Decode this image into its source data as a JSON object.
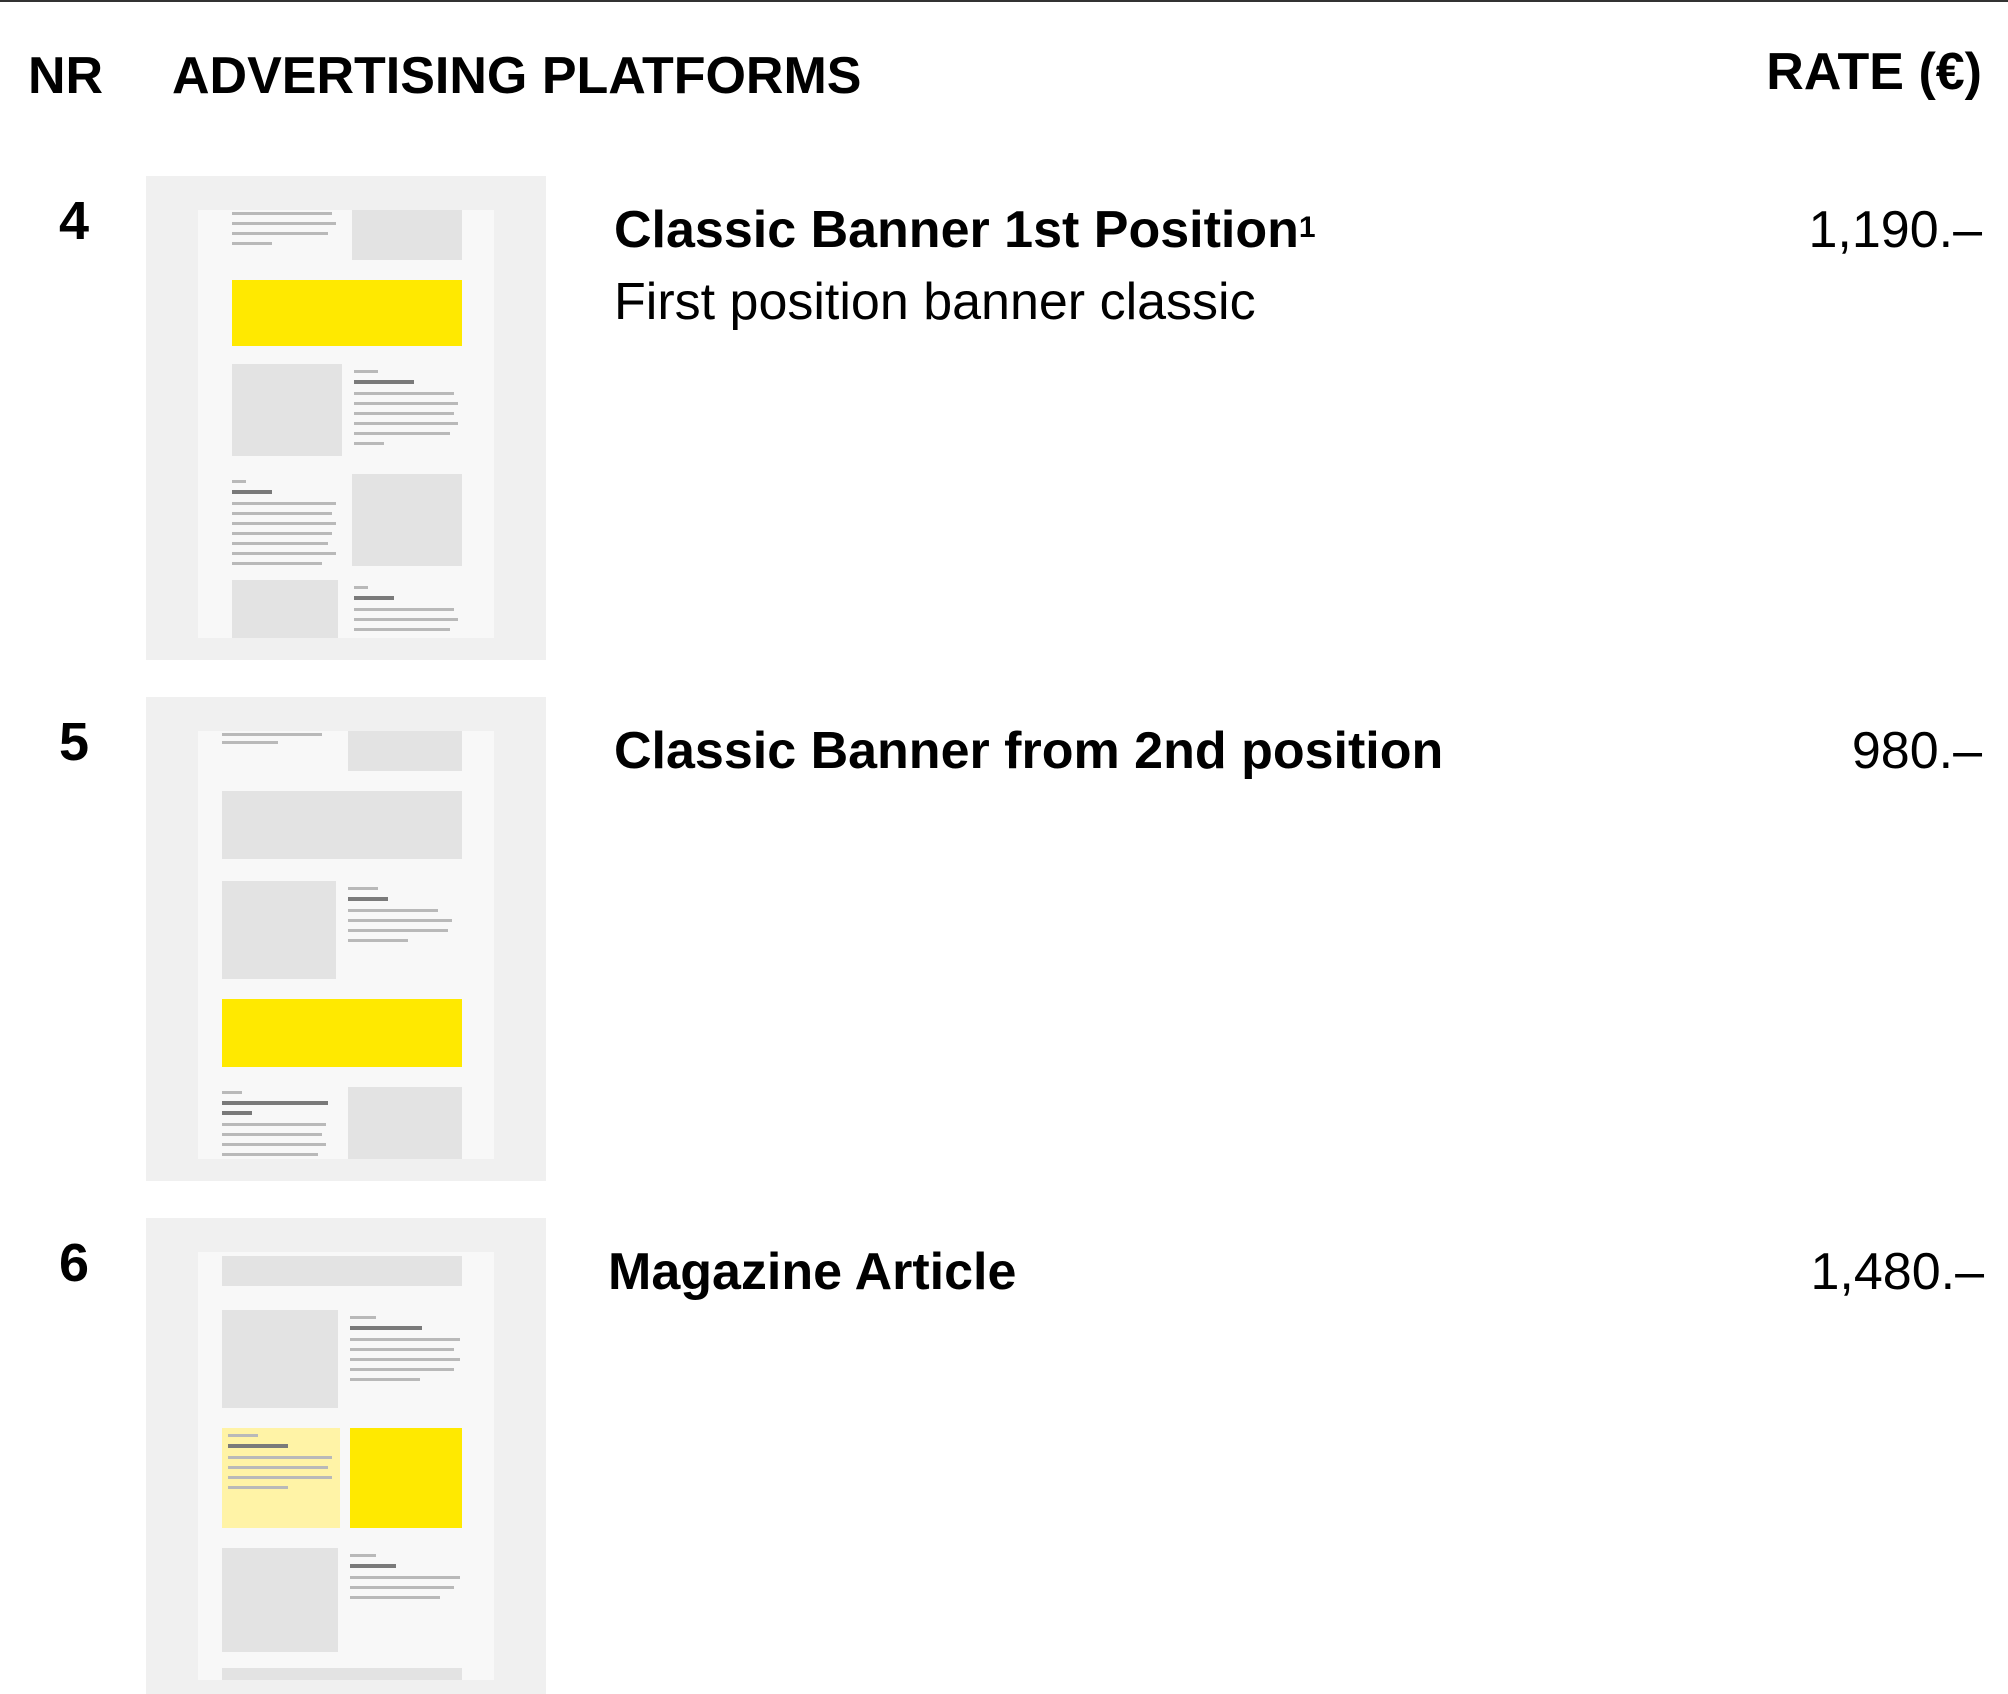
{
  "header": {
    "nr": "NR",
    "platforms": "ADVERTISING PLATFORMS",
    "rate": "RATE (€)"
  },
  "rows": [
    {
      "nr": "4",
      "title": "Classic Banner 1st Position",
      "footnote": "1",
      "subtitle": "First position banner classic",
      "rate": "1,190.–"
    },
    {
      "nr": "5",
      "title": "Classic Banner from 2nd position",
      "rate": "980.–"
    },
    {
      "nr": "6",
      "title": "Magazine Article",
      "rate": "1,480.–"
    }
  ],
  "colors": {
    "ad_yellow": "#ffe900",
    "ad_light_yellow": "#fff3a6",
    "thumb_bg": "#f0f0f0",
    "placeholder": "#e3e3e3"
  }
}
